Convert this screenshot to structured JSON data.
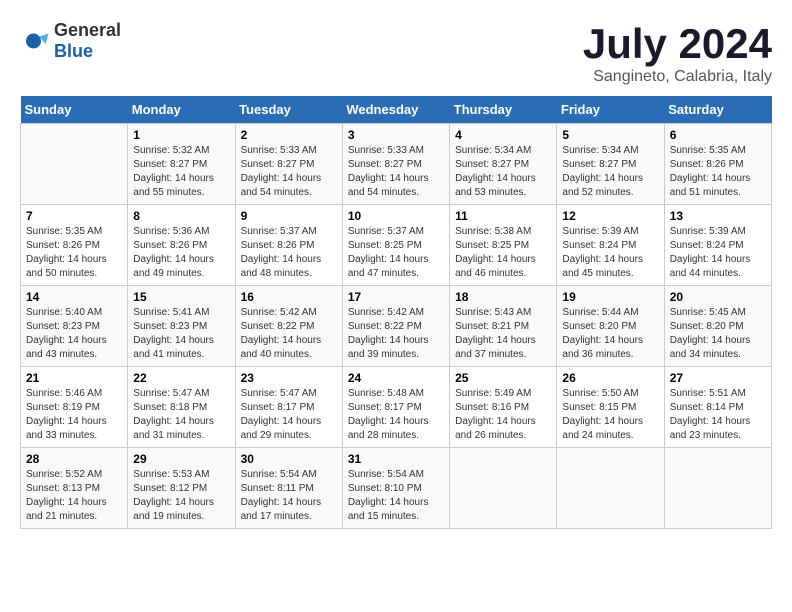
{
  "logo": {
    "general": "General",
    "blue": "Blue"
  },
  "title": "July 2024",
  "subtitle": "Sangineto, Calabria, Italy",
  "days_of_week": [
    "Sunday",
    "Monday",
    "Tuesday",
    "Wednesday",
    "Thursday",
    "Friday",
    "Saturday"
  ],
  "weeks": [
    [
      {
        "day": "",
        "info": ""
      },
      {
        "day": "1",
        "info": "Sunrise: 5:32 AM\nSunset: 8:27 PM\nDaylight: 14 hours\nand 55 minutes."
      },
      {
        "day": "2",
        "info": "Sunrise: 5:33 AM\nSunset: 8:27 PM\nDaylight: 14 hours\nand 54 minutes."
      },
      {
        "day": "3",
        "info": "Sunrise: 5:33 AM\nSunset: 8:27 PM\nDaylight: 14 hours\nand 54 minutes."
      },
      {
        "day": "4",
        "info": "Sunrise: 5:34 AM\nSunset: 8:27 PM\nDaylight: 14 hours\nand 53 minutes."
      },
      {
        "day": "5",
        "info": "Sunrise: 5:34 AM\nSunset: 8:27 PM\nDaylight: 14 hours\nand 52 minutes."
      },
      {
        "day": "6",
        "info": "Sunrise: 5:35 AM\nSunset: 8:26 PM\nDaylight: 14 hours\nand 51 minutes."
      }
    ],
    [
      {
        "day": "7",
        "info": "Sunrise: 5:35 AM\nSunset: 8:26 PM\nDaylight: 14 hours\nand 50 minutes."
      },
      {
        "day": "8",
        "info": "Sunrise: 5:36 AM\nSunset: 8:26 PM\nDaylight: 14 hours\nand 49 minutes."
      },
      {
        "day": "9",
        "info": "Sunrise: 5:37 AM\nSunset: 8:26 PM\nDaylight: 14 hours\nand 48 minutes."
      },
      {
        "day": "10",
        "info": "Sunrise: 5:37 AM\nSunset: 8:25 PM\nDaylight: 14 hours\nand 47 minutes."
      },
      {
        "day": "11",
        "info": "Sunrise: 5:38 AM\nSunset: 8:25 PM\nDaylight: 14 hours\nand 46 minutes."
      },
      {
        "day": "12",
        "info": "Sunrise: 5:39 AM\nSunset: 8:24 PM\nDaylight: 14 hours\nand 45 minutes."
      },
      {
        "day": "13",
        "info": "Sunrise: 5:39 AM\nSunset: 8:24 PM\nDaylight: 14 hours\nand 44 minutes."
      }
    ],
    [
      {
        "day": "14",
        "info": "Sunrise: 5:40 AM\nSunset: 8:23 PM\nDaylight: 14 hours\nand 43 minutes."
      },
      {
        "day": "15",
        "info": "Sunrise: 5:41 AM\nSunset: 8:23 PM\nDaylight: 14 hours\nand 41 minutes."
      },
      {
        "day": "16",
        "info": "Sunrise: 5:42 AM\nSunset: 8:22 PM\nDaylight: 14 hours\nand 40 minutes."
      },
      {
        "day": "17",
        "info": "Sunrise: 5:42 AM\nSunset: 8:22 PM\nDaylight: 14 hours\nand 39 minutes."
      },
      {
        "day": "18",
        "info": "Sunrise: 5:43 AM\nSunset: 8:21 PM\nDaylight: 14 hours\nand 37 minutes."
      },
      {
        "day": "19",
        "info": "Sunrise: 5:44 AM\nSunset: 8:20 PM\nDaylight: 14 hours\nand 36 minutes."
      },
      {
        "day": "20",
        "info": "Sunrise: 5:45 AM\nSunset: 8:20 PM\nDaylight: 14 hours\nand 34 minutes."
      }
    ],
    [
      {
        "day": "21",
        "info": "Sunrise: 5:46 AM\nSunset: 8:19 PM\nDaylight: 14 hours\nand 33 minutes."
      },
      {
        "day": "22",
        "info": "Sunrise: 5:47 AM\nSunset: 8:18 PM\nDaylight: 14 hours\nand 31 minutes."
      },
      {
        "day": "23",
        "info": "Sunrise: 5:47 AM\nSunset: 8:17 PM\nDaylight: 14 hours\nand 29 minutes."
      },
      {
        "day": "24",
        "info": "Sunrise: 5:48 AM\nSunset: 8:17 PM\nDaylight: 14 hours\nand 28 minutes."
      },
      {
        "day": "25",
        "info": "Sunrise: 5:49 AM\nSunset: 8:16 PM\nDaylight: 14 hours\nand 26 minutes."
      },
      {
        "day": "26",
        "info": "Sunrise: 5:50 AM\nSunset: 8:15 PM\nDaylight: 14 hours\nand 24 minutes."
      },
      {
        "day": "27",
        "info": "Sunrise: 5:51 AM\nSunset: 8:14 PM\nDaylight: 14 hours\nand 23 minutes."
      }
    ],
    [
      {
        "day": "28",
        "info": "Sunrise: 5:52 AM\nSunset: 8:13 PM\nDaylight: 14 hours\nand 21 minutes."
      },
      {
        "day": "29",
        "info": "Sunrise: 5:53 AM\nSunset: 8:12 PM\nDaylight: 14 hours\nand 19 minutes."
      },
      {
        "day": "30",
        "info": "Sunrise: 5:54 AM\nSunset: 8:11 PM\nDaylight: 14 hours\nand 17 minutes."
      },
      {
        "day": "31",
        "info": "Sunrise: 5:54 AM\nSunset: 8:10 PM\nDaylight: 14 hours\nand 15 minutes."
      },
      {
        "day": "",
        "info": ""
      },
      {
        "day": "",
        "info": ""
      },
      {
        "day": "",
        "info": ""
      }
    ]
  ]
}
